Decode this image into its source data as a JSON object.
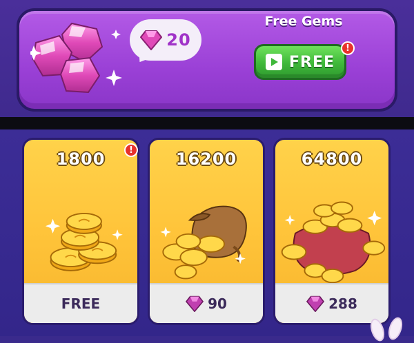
{
  "banner": {
    "gem_count": "20",
    "title": "Free Gems",
    "button_label": "FREE",
    "alert": "!"
  },
  "offers": [
    {
      "amount": "1800",
      "price": "FREE",
      "price_icon": "none",
      "alert": "!",
      "art": "coin-stack-icon"
    },
    {
      "amount": "16200",
      "price": "90",
      "price_icon": "gem-icon",
      "art": "coin-sack-icon"
    },
    {
      "amount": "64800",
      "price": "288",
      "price_icon": "gem-icon",
      "art": "coin-bag-icon"
    }
  ],
  "colors": {
    "background": "#3a2a8c",
    "banner": "#a84cde",
    "gem": "#e04ab8",
    "button_green": "#3fb83a",
    "card_gold": "#ffc43a",
    "badge_red": "#e8322b"
  }
}
